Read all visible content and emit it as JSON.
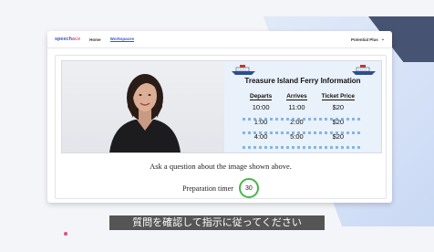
{
  "app": {
    "logo_main": "speech",
    "logo_accent": "ace"
  },
  "nav": {
    "items": [
      {
        "label": "Home",
        "active": false
      },
      {
        "label": "Workspaces",
        "active": true
      }
    ],
    "user_label": "Potential Plus"
  },
  "info_panel": {
    "title": "Treasure Island Ferry Information",
    "columns": [
      "Departs",
      "Arrives",
      "Ticket Price"
    ],
    "rows": [
      [
        "10:00",
        "11:00",
        "$20"
      ],
      [
        "1:00",
        "2:00",
        "$20"
      ],
      [
        "4:00",
        "5:00",
        "$20"
      ]
    ]
  },
  "prompt_text": "Ask a question about the image shown above.",
  "timer": {
    "label": "Preparation timer",
    "value": "30"
  },
  "subtitle": "質問を確認して指示に従ってください",
  "colors": {
    "accent": "#2f5cc9",
    "timer_ring": "#48b648",
    "info_bg": "#e9f1fb"
  },
  "icons": [
    "ship-icon",
    "chevron-down-icon"
  ]
}
